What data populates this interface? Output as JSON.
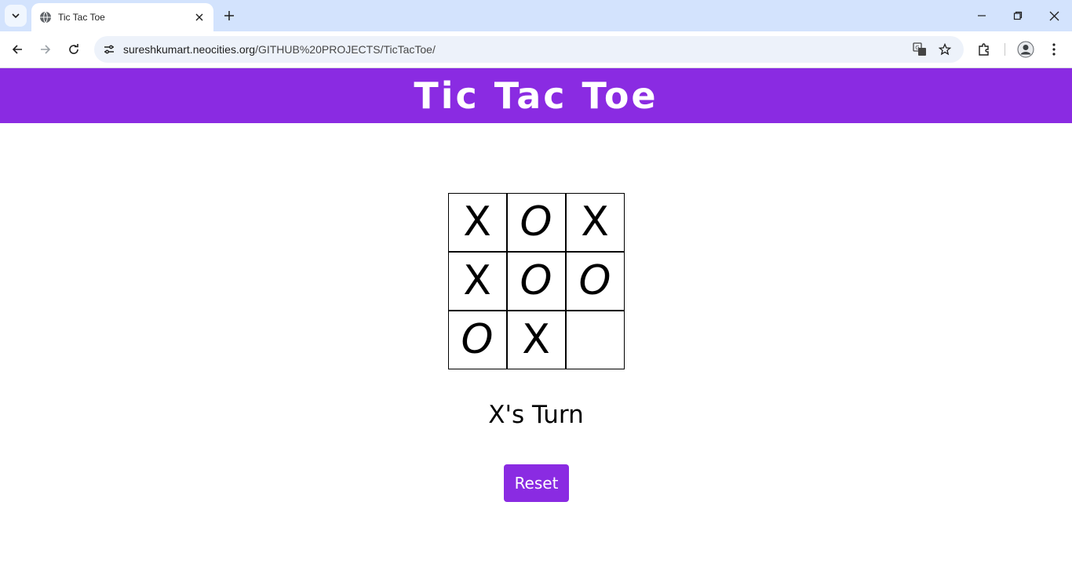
{
  "browser": {
    "tab_title": "Tic Tac Toe",
    "url_host": "sureshkumart.neocities.org",
    "url_path": "/GITHUB%20PROJECTS/TicTacToe/"
  },
  "page": {
    "title": "Tic Tac Toe",
    "status": "X's Turn",
    "reset_label": "Reset"
  },
  "board": {
    "cells": [
      "X",
      "O",
      "X",
      "X",
      "O",
      "O",
      "O",
      "X",
      ""
    ]
  },
  "colors": {
    "accent": "#8a2be2",
    "tabstrip": "#d3e3fd",
    "omnibox": "#edf2fa"
  },
  "icons": [
    "tab-search-icon",
    "globe-icon",
    "close-icon",
    "plus-icon",
    "minimize-icon",
    "restore-icon",
    "back-icon",
    "forward-icon",
    "reload-icon",
    "site-settings-icon",
    "translate-icon",
    "star-icon",
    "extensions-icon",
    "profile-icon",
    "kebab-menu-icon"
  ]
}
